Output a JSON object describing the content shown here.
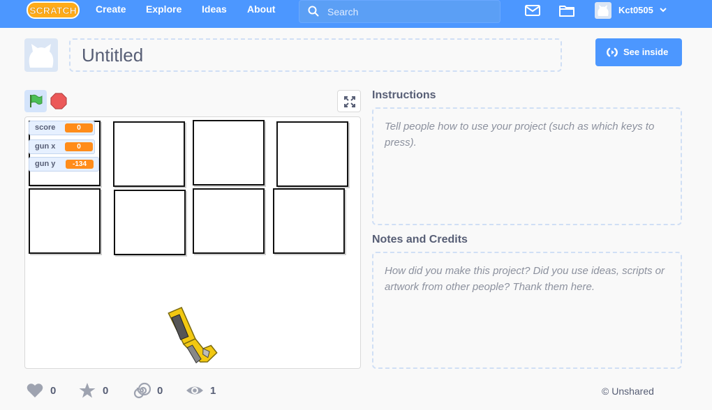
{
  "nav": {
    "logo_text": "SCRATCH",
    "links": [
      "Create",
      "Explore",
      "Ideas",
      "About"
    ],
    "search_placeholder": "Search",
    "username": "Kct0505",
    "icons": [
      "mail-icon",
      "folder-icon"
    ]
  },
  "project": {
    "title": "Untitled",
    "see_inside_label": "See inside"
  },
  "stage": {
    "monitors": [
      {
        "label": "score",
        "value": "0"
      },
      {
        "label": "gun x",
        "value": "0"
      },
      {
        "label": "gun y",
        "value": "-134"
      }
    ]
  },
  "instructions": {
    "heading": "Instructions",
    "placeholder": "Tell people how to use your project (such as which keys to press)."
  },
  "notes": {
    "heading": "Notes and Credits",
    "placeholder": "How did you make this project? Did you use ideas, scripts or artwork from other people? Thank them here."
  },
  "stats": {
    "loves": "0",
    "favorites": "0",
    "remixes": "0",
    "views": "1"
  },
  "share_status": "© Unshared",
  "colors": {
    "brand_blue": "#4c97ff",
    "monitor_orange": "#ff8c1a",
    "text": "#575e75"
  }
}
